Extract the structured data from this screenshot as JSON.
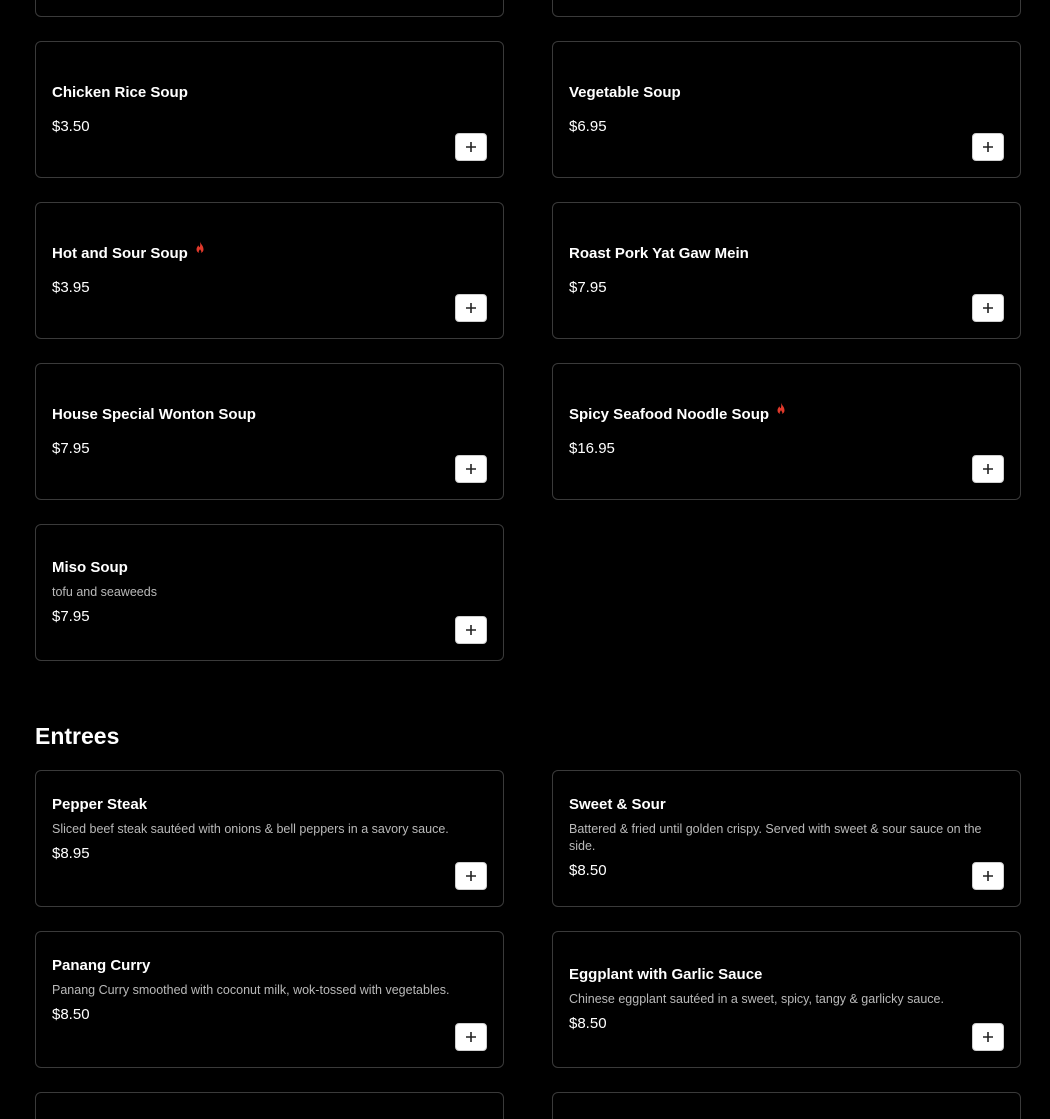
{
  "colors": {
    "background": "#000000",
    "card_border": "#3a3a3a",
    "text": "#ffffff",
    "description": "#b9b9b9",
    "spicy": "#e0392b",
    "add_button": "#ffffff"
  },
  "soups": {
    "items": [
      {
        "name": "Chicken Rice Soup",
        "price": "$3.50",
        "spicy": false
      },
      {
        "name": "Vegetable Soup",
        "price": "$6.95",
        "spicy": false
      },
      {
        "name": "Hot and Sour Soup",
        "price": "$3.95",
        "spicy": true,
        "icon": "flame-icon"
      },
      {
        "name": "Roast Pork Yat Gaw Mein",
        "price": "$7.95",
        "spicy": false
      },
      {
        "name": "House Special Wonton Soup",
        "price": "$7.95",
        "spicy": false
      },
      {
        "name": "Spicy Seafood Noodle Soup",
        "price": "$16.95",
        "spicy": true,
        "icon": "flame-icon"
      },
      {
        "name": "Miso Soup",
        "description": "tofu and seaweeds",
        "price": "$7.95",
        "spicy": false
      }
    ]
  },
  "entrees": {
    "title": "Entrees",
    "items": [
      {
        "name": "Pepper Steak",
        "description": "Sliced beef steak sautéed with onions & bell peppers in a savory sauce.",
        "price": "$8.95"
      },
      {
        "name": "Sweet & Sour",
        "description": "Battered & fried until golden crispy. Served with sweet & sour sauce on the side.",
        "price": "$8.50"
      },
      {
        "name": "Panang Curry",
        "description": "Panang Curry smoothed with coconut milk, wok-tossed with vegetables.",
        "price": "$8.50"
      },
      {
        "name": "Eggplant with Garlic Sauce",
        "description": "Chinese eggplant sautéed in a sweet, spicy, tangy & garlicky sauce.",
        "price": "$8.50"
      }
    ]
  },
  "add_button_icon": "plus-icon"
}
